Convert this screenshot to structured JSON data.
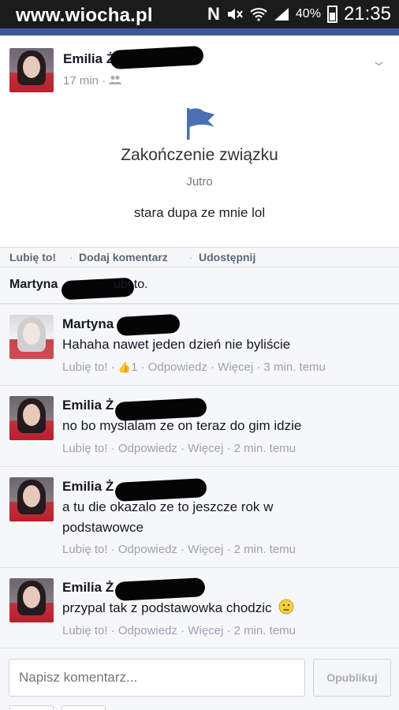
{
  "watermark": "www.wiocha.pl",
  "status_bar": {
    "battery": "40%",
    "time": "21:35",
    "nfc": "N"
  },
  "post": {
    "author_first": "Emilia",
    "author_initial": "Ż",
    "time": "17 min",
    "sep": "·",
    "event_title": "Zakończenie związku",
    "event_when": "Jutro",
    "event_text": "stara dupa ze mnie lol"
  },
  "actions": {
    "like": "Lubię to!",
    "comment": "Dodaj komentarz",
    "share": "Udostępnij",
    "sep": "·"
  },
  "likes": {
    "who": "Martyna",
    "rest": "ubi to."
  },
  "comments": [
    {
      "author": "Martyna",
      "text": "Hahaha nawet jeden dzień nie byliście",
      "like": "Lubię to!",
      "like_count": "1",
      "reply": "Odpowiedz",
      "more": "Więcej",
      "time": "3 min. temu"
    },
    {
      "author": "Emilia",
      "initial": "Ż",
      "text": "no bo myslalam ze on teraz do gim idzie",
      "like": "Lubię to!",
      "reply": "Odpowiedz",
      "more": "Więcej",
      "time": "2 min. temu"
    },
    {
      "author": "Emilia",
      "initial": "Ż",
      "text": "a tu die okazalo ze to jeszcze rok w podstawowce",
      "like": "Lubię to!",
      "reply": "Odpowiedz",
      "more": "Więcej",
      "time": "2 min. temu"
    },
    {
      "author": "Emilia",
      "initial": "Ż",
      "text": "przypal tak z podstawowka chodzic",
      "like": "Lubię to!",
      "reply": "Odpowiedz",
      "more": "Więcej",
      "time": "2 min. temu"
    }
  ],
  "composer": {
    "placeholder": "Napisz komentarz...",
    "publish": "Opublikuj"
  },
  "icons": {
    "flag": "flag-icon",
    "friends": "friends-icon",
    "chevron": "chevron-down-icon",
    "like_thumb": "thumbs-up-icon",
    "smiley": "smiley-icon"
  },
  "colors": {
    "facebook_blue": "#3b5998",
    "flag_blue": "#4a6fb5",
    "meta_grey": "#90949c"
  }
}
